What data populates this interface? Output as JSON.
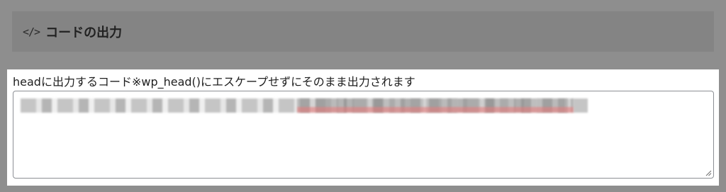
{
  "section": {
    "icon": "code-icon",
    "icon_glyph": "</>",
    "title": "コードの出力"
  },
  "field": {
    "label": "headに出力するコード※wp_head()にエスケープせずにそのまま出力されます",
    "value": ""
  },
  "colors": {
    "page_background": "#8e8e8e",
    "header_background": "#848484",
    "panel_background": "#ffffff",
    "textarea_border": "#8c8f94",
    "highlight": "#eb7878"
  }
}
